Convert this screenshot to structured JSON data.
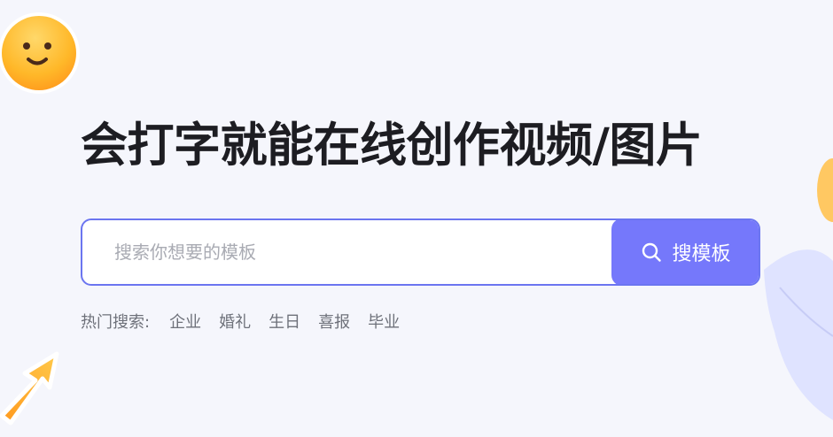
{
  "hero": {
    "headline": "会打字就能在线创作视频/图片"
  },
  "search": {
    "placeholder": "搜索你想要的模板",
    "value": "",
    "button_label": "搜模板",
    "button_icon": "search-icon"
  },
  "hot_searches": {
    "label": "热门搜索:",
    "items": [
      "企业",
      "婚礼",
      "生日",
      "喜报",
      "毕业"
    ]
  },
  "decorations": {
    "smiley_icon": "smiley-face-icon",
    "arrow_icon": "arrow-up-right-icon",
    "leaf_icon": "leaf-icon"
  },
  "colors": {
    "page_background": "#f5f6fc",
    "accent": "#7578fb",
    "search_border": "#6b75f0",
    "headline": "#1d1d22",
    "muted_text": "#6e717a",
    "decor_orange": "#ffbe3d"
  }
}
